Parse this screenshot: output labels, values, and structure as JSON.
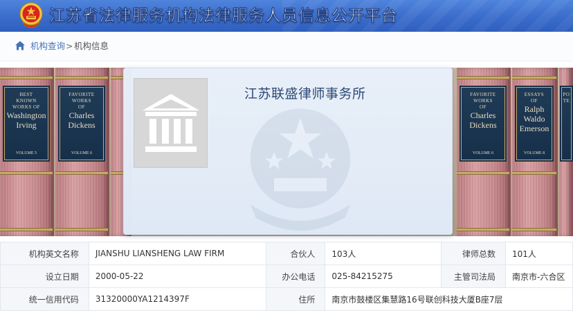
{
  "header": {
    "site_title": "江苏省法律服务机构法律服务人员信息公开平台",
    "emblem_icon": "national-emblem-icon"
  },
  "breadcrumb": {
    "home_icon": "home-icon",
    "link": "机构查询",
    "separator": ">",
    "current": "机构信息"
  },
  "banner": {
    "books": [
      {
        "lines": [
          "BEST",
          "KNOWN",
          "WORKS OF"
        ],
        "big": [
          "Washington",
          "Irving"
        ],
        "volume": "VOLUME 5"
      },
      {
        "lines": [
          "FAVORITE",
          "WORKS",
          "OF"
        ],
        "big": [
          "Charles",
          "Dickens"
        ],
        "volume": "VOLUME 6"
      },
      {
        "lines": [
          "FAVORITE",
          "WORKS",
          "OF"
        ],
        "big": [
          "Charles",
          "Dickens"
        ],
        "volume": "VOLUME 6"
      },
      {
        "lines": [
          "ESSAYS",
          "OF"
        ],
        "big": [
          "Ralph",
          "Waldo",
          "Emerson"
        ],
        "volume": "VOLUME 8"
      },
      {
        "lines": [
          "PO",
          "TE"
        ],
        "big": [],
        "volume": ""
      }
    ]
  },
  "card": {
    "firm_name": "江苏联盛律师事务所",
    "logo_icon": "courthouse-icon"
  },
  "info": {
    "rows": [
      [
        {
          "label": "机构英文名称",
          "value": "JIANSHU LIANSHENG LAW FIRM"
        },
        {
          "label": "合伙人",
          "value": "103人"
        },
        {
          "label": "律师总数",
          "value": "101人"
        }
      ],
      [
        {
          "label": "设立日期",
          "value": "2000-05-22"
        },
        {
          "label": "办公电话",
          "value": "025-84215275"
        },
        {
          "label": "主管司法局",
          "value": "南京市-六合区"
        }
      ],
      [
        {
          "label": "统一信用代码",
          "value": "31320000YA1214397F"
        },
        {
          "label": "住所",
          "value": "南京市鼓楼区集慧路16号联创科技大厦B座7层"
        }
      ]
    ]
  },
  "colors": {
    "header_blue": "#3a6ccb",
    "link_blue": "#4573b7",
    "firm_name": "#2d4a75",
    "table_key_bg": "#f4f6f9"
  }
}
